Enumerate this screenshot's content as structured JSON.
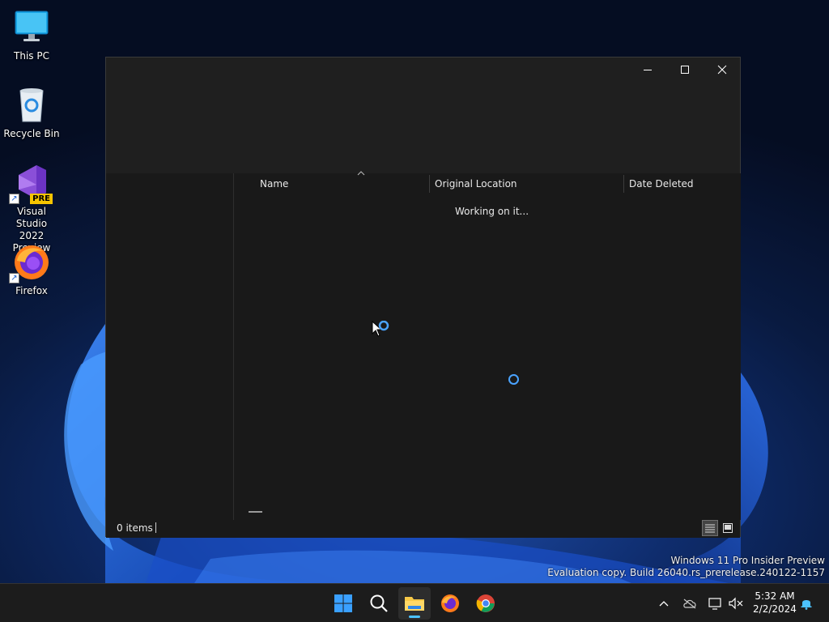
{
  "desktop": {
    "icons": [
      {
        "label_line1": "This PC",
        "label_line2": "",
        "icon": "monitor-icon"
      },
      {
        "label_line1": "Recycle Bin",
        "label_line2": "",
        "icon": "recycle-bin-icon"
      },
      {
        "label_line1": "Visual Studio",
        "label_line2": "2022 Preview",
        "icon": "visual-studio-preview-icon",
        "badge": "PRE"
      },
      {
        "label_line1": "Firefox",
        "label_line2": "",
        "icon": "firefox-icon"
      }
    ]
  },
  "window": {
    "columns": [
      "Name",
      "Original Location",
      "Date Deleted"
    ],
    "loading_text": "Working on it...",
    "status": {
      "item_count": "0 items"
    },
    "caption": {
      "minimize": "minimize-icon",
      "maximize": "maximize-icon",
      "close": "close-icon"
    }
  },
  "watermark": {
    "line1": "Windows 11 Pro Insider Preview",
    "line2": "Evaluation copy. Build 26040.rs_prerelease.240122-1157"
  },
  "taskbar": {
    "apps": [
      "start-icon",
      "search-icon",
      "file-explorer-icon",
      "firefox-icon",
      "chrome-icon"
    ],
    "tray": [
      "chevron-up-icon",
      "cloud-offline-icon",
      "network-icon",
      "volume-muted-icon",
      "notification-bell-icon"
    ],
    "clock": {
      "time": "5:32 AM",
      "date": "2/2/2024"
    }
  },
  "colors": {
    "accent": "#4cc2ff",
    "window_bg": "#191919",
    "taskbar_bg": "#1c1c1c"
  }
}
